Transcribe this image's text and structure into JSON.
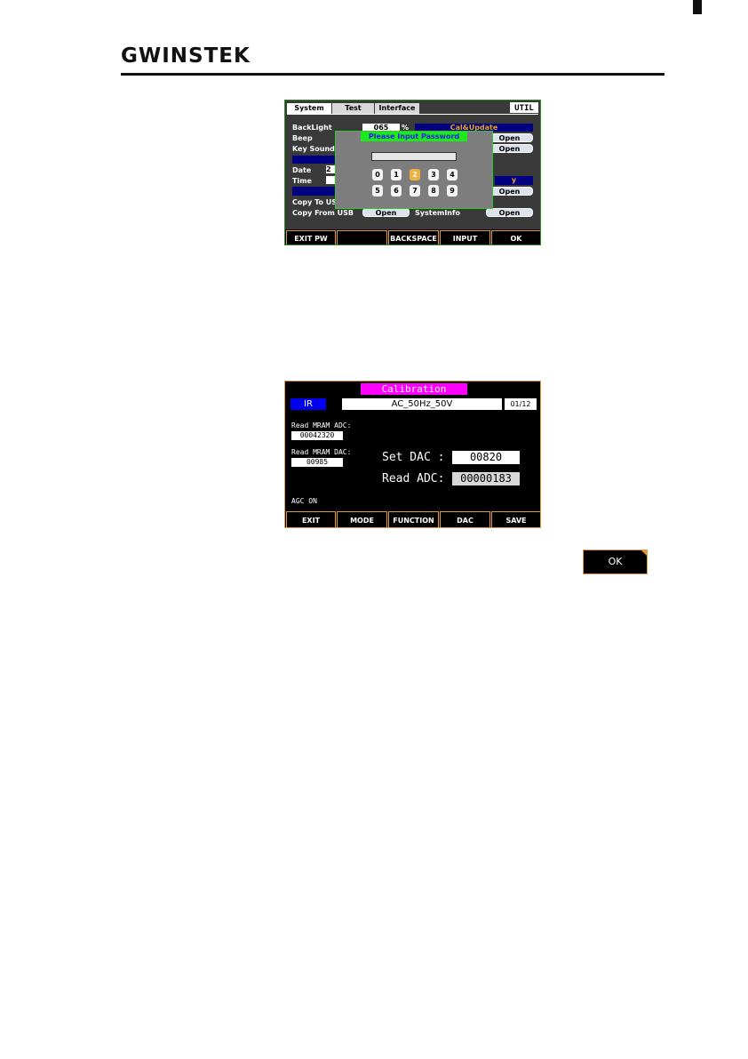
{
  "header": {
    "brand": "GWINSTEK"
  },
  "util_screen": {
    "tabs": [
      "System",
      "Test",
      "Interface"
    ],
    "mode_label": "UTIL",
    "backlight_label": "BackLight",
    "backlight_value": "065",
    "backlight_unit": "%",
    "beep_label": "Beep",
    "key_sound_label": "Key Sound",
    "date_label": "Date",
    "date_value": "2",
    "time_label": "Time",
    "copy_to_usb_label": "Copy To US",
    "copy_from_usb_label": "Copy From USB",
    "cal_update_label": "Cal&Update",
    "system_info_label": "SystemInfo",
    "open_label": "Open",
    "right_bar_text": "y",
    "dialog": {
      "title": "Please Input Password",
      "keys": [
        "0",
        "1",
        "2",
        "3",
        "4",
        "5",
        "6",
        "7",
        "8",
        "9"
      ],
      "selected_key": "2"
    },
    "softkeys": [
      "EXIT PW",
      "",
      "BACKSPACE",
      "INPUT",
      "OK"
    ]
  },
  "cal_screen": {
    "title": "Calibration",
    "mode": "IR",
    "function": "AC_50Hz_50V",
    "step": "01/12",
    "read_mram_adc_label": "Read MRAM ADC:",
    "read_mram_adc_value": "00042320",
    "read_mram_dac_label": "Read MRAM DAC:",
    "read_mram_dac_value": "00985",
    "set_dac_label": "Set DAC :",
    "set_dac_value": "00820",
    "read_adc_label": "Read ADC:",
    "read_adc_value": "00000183",
    "agc_status": "AGC ON",
    "softkeys": [
      "EXIT",
      "MODE",
      "FUNCTION",
      "DAC",
      "SAVE"
    ]
  },
  "ok_key": {
    "label": "OK"
  }
}
